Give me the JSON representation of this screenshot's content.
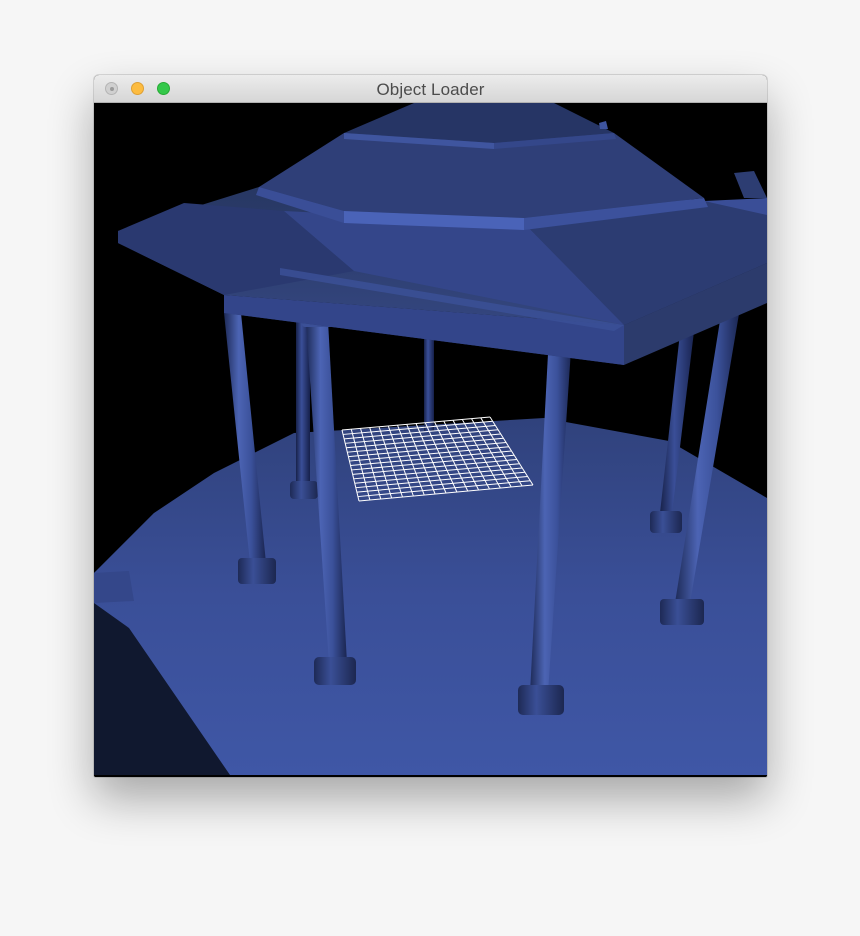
{
  "window": {
    "title": "Object Loader",
    "buttons": [
      "close",
      "minimize",
      "zoom"
    ]
  },
  "viewport": {
    "scene": "gazebo",
    "object_color": "#3d55a3",
    "background_color": "#000000",
    "grid_color": "#ffffff",
    "grid_divisions": 16
  },
  "colors": {
    "close": "#d0d0d0",
    "minimize": "#fdbc40",
    "zoom": "#34c84a"
  }
}
